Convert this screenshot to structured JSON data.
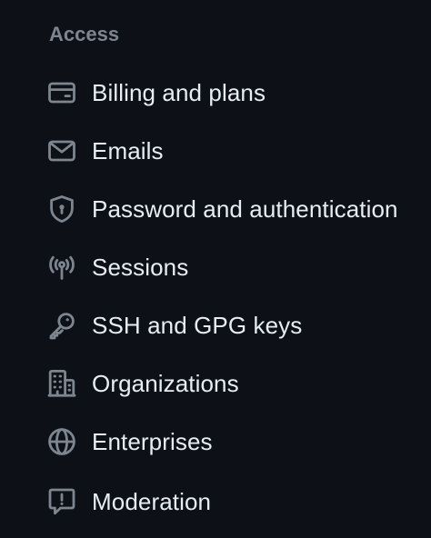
{
  "sidebar": {
    "section_heading": "Access",
    "items": [
      {
        "label": "Billing and plans",
        "icon": "credit-card-icon"
      },
      {
        "label": "Emails",
        "icon": "mail-icon"
      },
      {
        "label": "Password and authentication",
        "icon": "shield-lock-icon"
      },
      {
        "label": "Sessions",
        "icon": "broadcast-icon"
      },
      {
        "label": "SSH and GPG keys",
        "icon": "key-icon"
      },
      {
        "label": "Organizations",
        "icon": "organization-icon"
      },
      {
        "label": "Enterprises",
        "icon": "globe-icon"
      },
      {
        "label": "Moderation",
        "icon": "report-icon"
      }
    ]
  },
  "colors": {
    "background": "#0d1117",
    "heading": "#7d8590",
    "text": "#e6edf3",
    "icon": "#7d8590"
  }
}
